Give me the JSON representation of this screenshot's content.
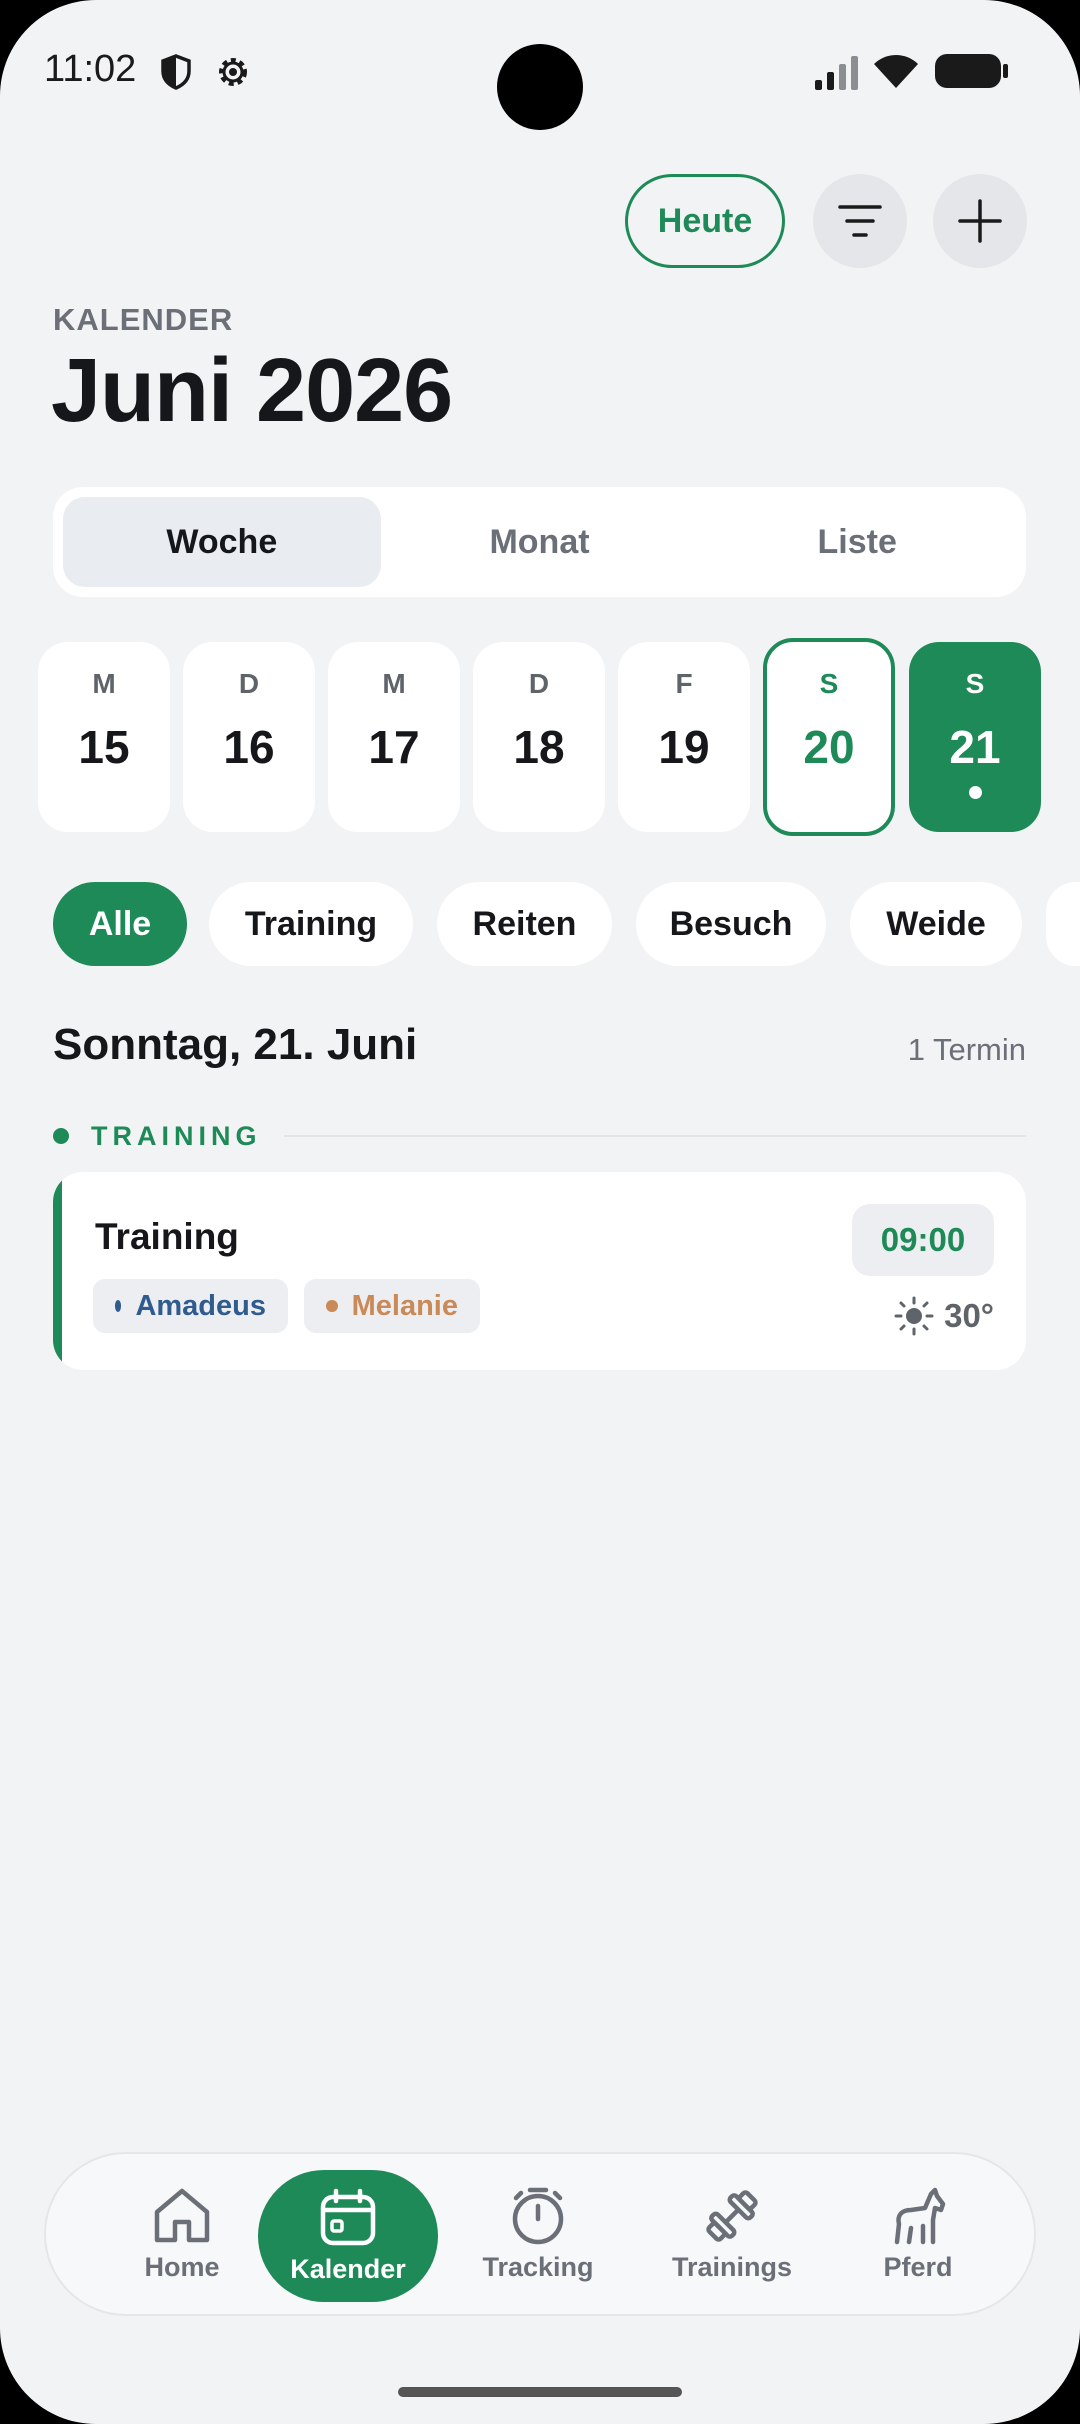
{
  "status": {
    "time": "11:02"
  },
  "header": {
    "today_label": "Heute",
    "eyebrow": "KALENDER",
    "title": "Juni 2026"
  },
  "view_tabs": [
    {
      "label": "Woche",
      "active": true
    },
    {
      "label": "Monat",
      "active": false
    },
    {
      "label": "Liste",
      "active": false
    }
  ],
  "week": [
    {
      "letter": "M",
      "num": "15"
    },
    {
      "letter": "D",
      "num": "16"
    },
    {
      "letter": "M",
      "num": "17"
    },
    {
      "letter": "D",
      "num": "18"
    },
    {
      "letter": "F",
      "num": "19"
    },
    {
      "letter": "S",
      "num": "20",
      "state": "today"
    },
    {
      "letter": "S",
      "num": "21",
      "state": "selected"
    }
  ],
  "filters": [
    {
      "label": "Alle",
      "active": true
    },
    {
      "label": "Training"
    },
    {
      "label": "Reiten"
    },
    {
      "label": "Besuch"
    },
    {
      "label": "Weide"
    }
  ],
  "day": {
    "heading": "Sonntag, 21. Juni",
    "count": "1 Termin"
  },
  "section": {
    "label": "TRAINING",
    "color": "#1e8a57"
  },
  "event": {
    "title": "Training",
    "time": "09:00",
    "temperature": "30°",
    "weather_icon": "sun-icon",
    "tags": [
      {
        "label": "Amadeus",
        "color": "#2f5b8f"
      },
      {
        "label": "Melanie",
        "color": "#c98a57"
      }
    ]
  },
  "nav": [
    {
      "label": "Home",
      "icon": "home-icon"
    },
    {
      "label": "Kalender",
      "icon": "calendar-icon",
      "active": true
    },
    {
      "label": "Tracking",
      "icon": "stopwatch-icon"
    },
    {
      "label": "Trainings",
      "icon": "dumbbell-icon"
    },
    {
      "label": "Pferd",
      "icon": "horse-icon"
    }
  ],
  "colors": {
    "accent": "#1e8a57",
    "background": "#f2f3f5"
  }
}
